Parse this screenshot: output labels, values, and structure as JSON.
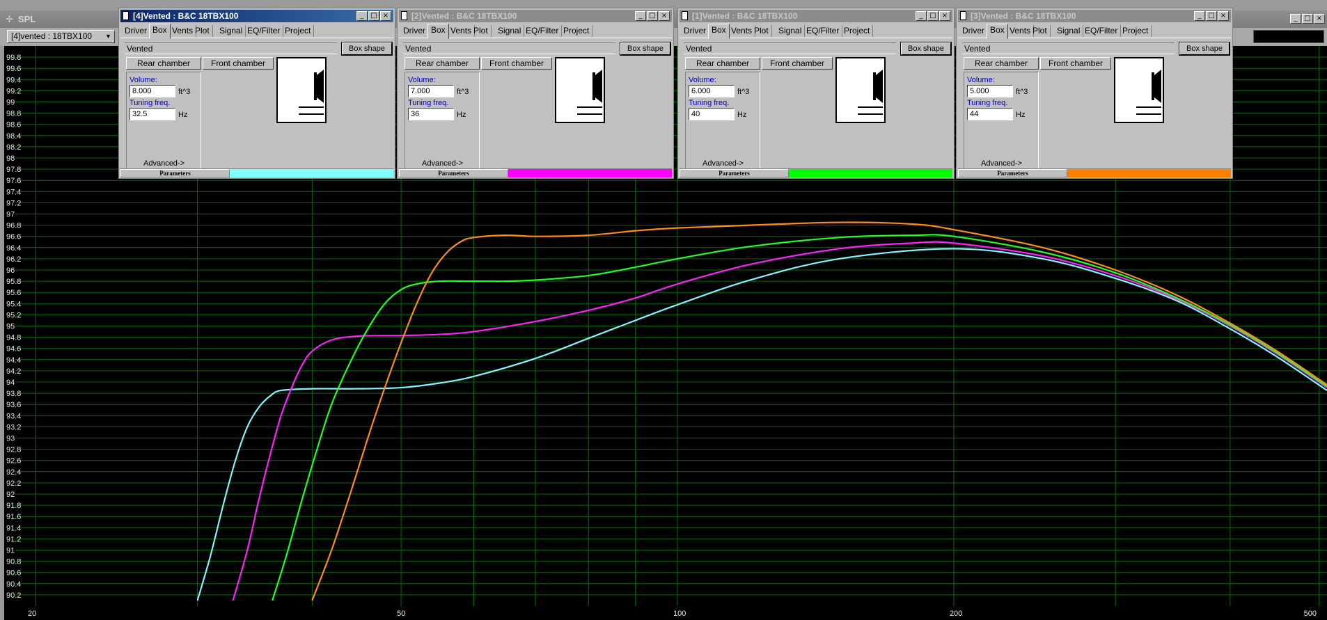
{
  "main": {
    "title": "SPL",
    "driver_select": "[4]vented : 18TBX100",
    "icons": {
      "app": "speaker-icon",
      "dropdown": "dropdown-arrow-icon"
    }
  },
  "chart_data": {
    "type": "line",
    "xscale": "log",
    "xlim": [
      19,
      510
    ],
    "ylim": [
      90,
      100
    ],
    "y_ticks": [
      "99.8",
      "99.6",
      "99.4",
      "99.2",
      "99",
      "98.8",
      "98.6",
      "98.4",
      "98.2",
      "98",
      "97.8",
      "97.6",
      "97.4",
      "97.2",
      "97",
      "96.8",
      "96.6",
      "96.4",
      "96.2",
      "96",
      "95.8",
      "95.6",
      "95.4",
      "95.2",
      "95",
      "94.8",
      "94.6",
      "94.4",
      "94.2",
      "94",
      "93.8",
      "93.6",
      "93.4",
      "93.2",
      "93",
      "92.8",
      "92.6",
      "92.4",
      "92.2",
      "92",
      "91.8",
      "91.6",
      "91.4",
      "91.2",
      "91",
      "90.8",
      "90.6",
      "90.4",
      "90.2"
    ],
    "x_ticks": [
      "20",
      "50",
      "100",
      "200",
      "500"
    ],
    "x_ticks_numeric": [
      20,
      50,
      100,
      200,
      500
    ],
    "grid": true,
    "series": [
      {
        "color": "#7ff5ff",
        "points": [
          [
            30,
            90.1
          ],
          [
            31,
            90.9
          ],
          [
            32,
            91.8
          ],
          [
            33,
            92.6
          ],
          [
            34,
            93.2
          ],
          [
            35,
            93.55
          ],
          [
            36,
            93.75
          ],
          [
            37,
            93.85
          ],
          [
            40,
            93.88
          ],
          [
            45,
            93.88
          ],
          [
            50,
            93.9
          ],
          [
            55,
            93.98
          ],
          [
            60,
            94.1
          ],
          [
            70,
            94.42
          ],
          [
            80,
            94.78
          ],
          [
            90,
            95.1
          ],
          [
            100,
            95.38
          ],
          [
            120,
            95.82
          ],
          [
            150,
            96.2
          ],
          [
            200,
            96.38
          ],
          [
            250,
            96.2
          ],
          [
            300,
            95.85
          ],
          [
            350,
            95.45
          ],
          [
            400,
            94.95
          ],
          [
            450,
            94.45
          ],
          [
            510,
            93.85
          ]
        ]
      },
      {
        "color": "#ff20ff",
        "points": [
          [
            32.8,
            90.1
          ],
          [
            34,
            91.0
          ],
          [
            35,
            91.9
          ],
          [
            36,
            92.7
          ],
          [
            37,
            93.4
          ],
          [
            38,
            93.9
          ],
          [
            39,
            94.3
          ],
          [
            40,
            94.55
          ],
          [
            42,
            94.75
          ],
          [
            45,
            94.82
          ],
          [
            50,
            94.83
          ],
          [
            55,
            94.85
          ],
          [
            60,
            94.9
          ],
          [
            70,
            95.08
          ],
          [
            80,
            95.28
          ],
          [
            90,
            95.5
          ],
          [
            100,
            95.75
          ],
          [
            120,
            96.1
          ],
          [
            150,
            96.38
          ],
          [
            180,
            96.48
          ],
          [
            200,
            96.48
          ],
          [
            250,
            96.25
          ],
          [
            300,
            95.9
          ],
          [
            350,
            95.48
          ],
          [
            400,
            95.0
          ],
          [
            450,
            94.5
          ],
          [
            510,
            93.9
          ]
        ]
      },
      {
        "color": "#20ff20",
        "points": [
          [
            36.2,
            90.1
          ],
          [
            37.5,
            90.9
          ],
          [
            39,
            91.9
          ],
          [
            40.5,
            92.8
          ],
          [
            42,
            93.6
          ],
          [
            44,
            94.35
          ],
          [
            46,
            94.95
          ],
          [
            48,
            95.4
          ],
          [
            50,
            95.65
          ],
          [
            52,
            95.75
          ],
          [
            55,
            95.8
          ],
          [
            60,
            95.8
          ],
          [
            65,
            95.8
          ],
          [
            70,
            95.82
          ],
          [
            80,
            95.9
          ],
          [
            90,
            96.05
          ],
          [
            100,
            96.2
          ],
          [
            120,
            96.42
          ],
          [
            150,
            96.58
          ],
          [
            180,
            96.62
          ],
          [
            200,
            96.6
          ],
          [
            250,
            96.32
          ],
          [
            300,
            95.95
          ],
          [
            350,
            95.5
          ],
          [
            400,
            95.02
          ],
          [
            450,
            94.52
          ],
          [
            510,
            93.92
          ]
        ]
      },
      {
        "color": "#ff8c1a",
        "points": [
          [
            40,
            90.1
          ],
          [
            42,
            91.0
          ],
          [
            44,
            92.0
          ],
          [
            46,
            93.0
          ],
          [
            48,
            93.9
          ],
          [
            50,
            94.7
          ],
          [
            52,
            95.4
          ],
          [
            54,
            95.95
          ],
          [
            56,
            96.3
          ],
          [
            58,
            96.5
          ],
          [
            60,
            96.58
          ],
          [
            65,
            96.62
          ],
          [
            70,
            96.6
          ],
          [
            80,
            96.62
          ],
          [
            90,
            96.7
          ],
          [
            100,
            96.75
          ],
          [
            120,
            96.8
          ],
          [
            150,
            96.85
          ],
          [
            180,
            96.82
          ],
          [
            200,
            96.72
          ],
          [
            250,
            96.4
          ],
          [
            300,
            96.0
          ],
          [
            350,
            95.55
          ],
          [
            400,
            95.05
          ],
          [
            450,
            94.55
          ],
          [
            510,
            93.95
          ]
        ]
      }
    ]
  },
  "box_windows": [
    {
      "title": "[4]Vented : B&C 18TBX100",
      "active": true,
      "tabs": [
        "Driver",
        "Box",
        "Vents",
        "Plot",
        "Signal",
        "EQ/Filter",
        "Project"
      ],
      "box_type": "Vented",
      "box_shape_label": "Box shape",
      "rear_chamber_label": "Rear chamber",
      "front_chamber_label": "Front chamber",
      "volume_label": "Volume:",
      "volume_value": "8.000",
      "volume_unit": "ft^3",
      "tuning_label": "Tuning freq.",
      "tuning_value": "32.5",
      "tuning_unit": "Hz",
      "advanced_label": "Advanced->",
      "status_label": "Parameters",
      "color": "#80ffff"
    },
    {
      "title": "[2]Vented : B&C 18TBX100",
      "active": false,
      "tabs": [
        "Driver",
        "Box",
        "Vents",
        "Plot",
        "Signal",
        "EQ/Filter",
        "Project"
      ],
      "box_type": "Vented",
      "box_shape_label": "Box shape",
      "rear_chamber_label": "Rear chamber",
      "front_chamber_label": "Front chamber",
      "volume_label": "Volume:",
      "volume_value": "7.000",
      "volume_unit": "ft^3",
      "tuning_label": "Tuning freq.",
      "tuning_value": "36",
      "tuning_unit": "Hz",
      "advanced_label": "Advanced->",
      "status_label": "Parameters",
      "color": "#ff00ff"
    },
    {
      "title": "[1]Vented : B&C 18TBX100",
      "active": false,
      "tabs": [
        "Driver",
        "Box",
        "Vents",
        "Plot",
        "Signal",
        "EQ/Filter",
        "Project"
      ],
      "box_type": "Vented",
      "box_shape_label": "Box shape",
      "rear_chamber_label": "Rear chamber",
      "front_chamber_label": "Front chamber",
      "volume_label": "Volume:",
      "volume_value": "6.000",
      "volume_unit": "ft^3",
      "tuning_label": "Tuning freq.",
      "tuning_value": "40",
      "tuning_unit": "Hz",
      "advanced_label": "Advanced->",
      "status_label": "Parameters",
      "color": "#00ff00"
    },
    {
      "title": "[3]Vented : B&C 18TBX100",
      "active": false,
      "tabs": [
        "Driver",
        "Box",
        "Vents",
        "Plot",
        "Signal",
        "EQ/Filter",
        "Project"
      ],
      "box_type": "Vented",
      "box_shape_label": "Box shape",
      "rear_chamber_label": "Rear chamber",
      "front_chamber_label": "Front chamber",
      "volume_label": "Volume:",
      "volume_value": "5.000",
      "volume_unit": "ft^3",
      "tuning_label": "Tuning freq.",
      "tuning_value": "44",
      "tuning_unit": "Hz",
      "advanced_label": "Advanced->",
      "status_label": "Parameters",
      "color": "#ff8000"
    }
  ]
}
